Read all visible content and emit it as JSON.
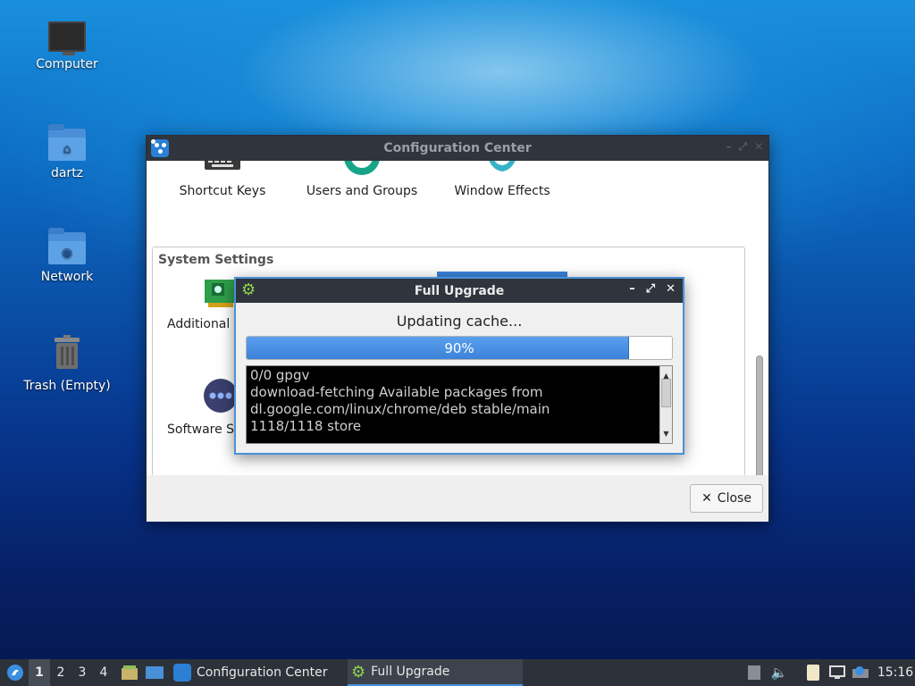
{
  "desktop": {
    "icons": [
      {
        "label": "Computer"
      },
      {
        "label": "dartz"
      },
      {
        "label": "Network"
      },
      {
        "label": "Trash (Empty)"
      }
    ]
  },
  "config_window": {
    "title": "Configuration Center",
    "top_items": [
      {
        "label": "Shortcut Keys"
      },
      {
        "label": "Users and Groups"
      },
      {
        "label": "Window Effects"
      }
    ],
    "section_title": "System Settings",
    "section_items": [
      {
        "label": "Additional"
      },
      {
        "label": "Software S"
      }
    ],
    "close_label": "Close"
  },
  "upgrade_dialog": {
    "title": "Full Upgrade",
    "status": "Updating cache...",
    "progress_percent": 90,
    "progress_label": "90%",
    "log_lines": [
      "0/0 gpgv",
      "download-fetching Available packages from",
      "dl.google.com/linux/chrome/deb stable/main",
      "1118/1118 store"
    ]
  },
  "taskbar": {
    "workspaces": [
      "1",
      "2",
      "3",
      "4"
    ],
    "tasks": [
      {
        "label": "Configuration Center"
      },
      {
        "label": "Full Upgrade"
      }
    ],
    "clock": "15:16"
  },
  "colors": {
    "accent": "#4a90d9",
    "titlebar": "#2f343d",
    "progress_fill": "#3b82d9"
  }
}
